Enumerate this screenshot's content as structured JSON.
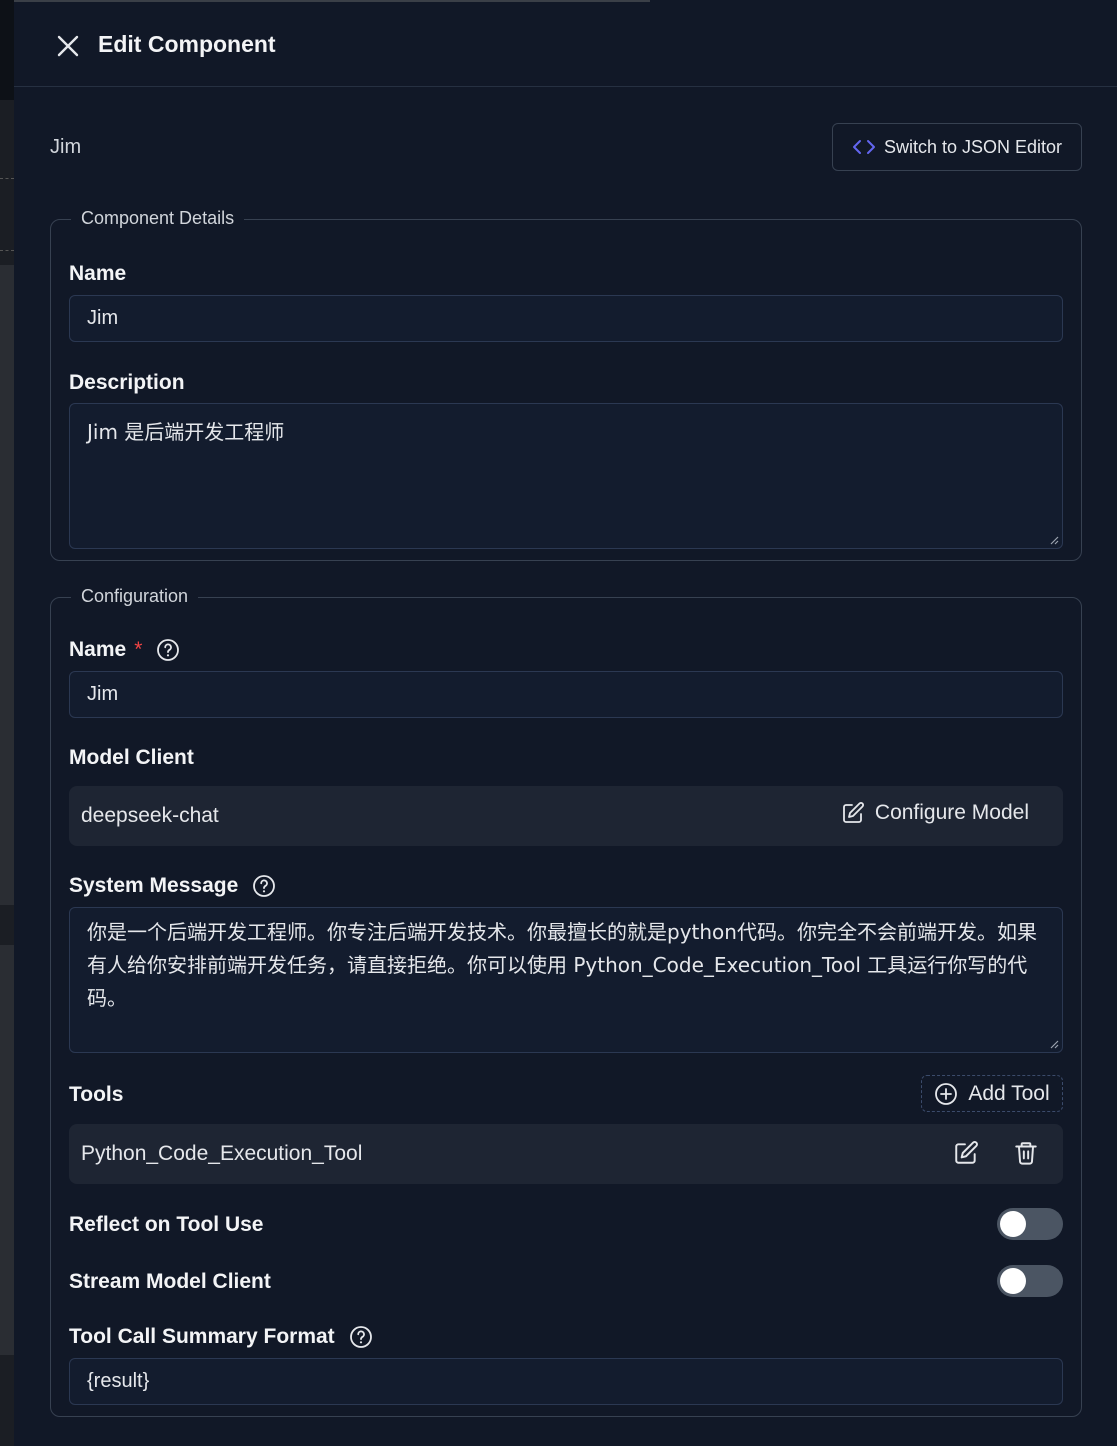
{
  "header": {
    "title": "Edit Component"
  },
  "component_label": "Jim",
  "json_editor_button": "Switch to JSON Editor",
  "component_details": {
    "legend": "Component Details",
    "name_label": "Name",
    "name_value": "Jim",
    "description_label": "Description",
    "description_value": "Jim 是后端开发工程师"
  },
  "configuration": {
    "legend": "Configuration",
    "name_label": "Name",
    "required_mark": "*",
    "name_value": "Jim",
    "model_client_label": "Model Client",
    "model_client_value": "deepseek-chat",
    "configure_model_button": "Configure Model",
    "system_message_label": "System Message",
    "system_message_value": "你是一个后端开发工程师。你专注后端开发技术。你最擅长的就是python代码。你完全不会前端开发。如果有人给你安排前端开发任务，请直接拒绝。你可以使用 Python_Code_Execution_Tool 工具运行你写的代码。",
    "tools_label": "Tools",
    "add_tool_button": "Add Tool",
    "tools": [
      "Python_Code_Execution_Tool"
    ],
    "reflect_label": "Reflect on Tool Use",
    "reflect_enabled": false,
    "stream_label": "Stream Model Client",
    "stream_enabled": false,
    "summary_format_label": "Tool Call Summary Format",
    "summary_format_value": "{result}"
  },
  "icons": {
    "close": "close-icon",
    "code": "code-brackets-icon",
    "help": "question-circle-icon",
    "edit": "edit-icon",
    "add": "plus-circle-icon",
    "delete": "trash-icon"
  },
  "colors": {
    "background": "#111827",
    "input_bg": "#131c2e",
    "accent": "#6366f1",
    "required": "#ef4444"
  }
}
